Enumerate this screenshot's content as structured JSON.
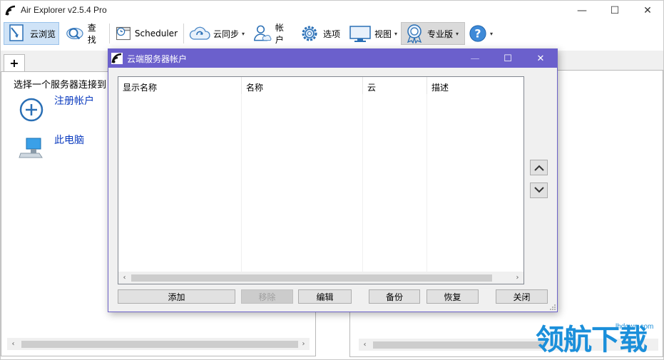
{
  "app": {
    "title": "Air Explorer v2.5.4 Pro"
  },
  "window_controls": {
    "minimize": "—",
    "maximize": "☐",
    "close": "✕"
  },
  "toolbar": {
    "browse": "云浏览",
    "search": "查找",
    "scheduler": "Scheduler",
    "sync": "云同步",
    "accounts": "帐户",
    "options": "选项",
    "view": "视图",
    "pro": "专业版",
    "caret": "▾"
  },
  "tabs": {
    "add": "+"
  },
  "left_pane": {
    "prompt": "选择一个服务器连接到",
    "items": [
      {
        "label": "注册帐户",
        "icon": "add-circle-icon"
      },
      {
        "label": "此电脑",
        "icon": "computer-icon"
      }
    ]
  },
  "dialog": {
    "title": "云端服务器帐户",
    "columns": [
      "显示名称",
      "名称",
      "云",
      "描述"
    ],
    "buttons": {
      "add": "添加",
      "remove": "移除",
      "edit": "编辑",
      "backup": "备份",
      "restore": "恢复",
      "close": "关闭"
    },
    "controls": {
      "minimize": "—",
      "maximize": "☐",
      "close": "✕"
    }
  },
  "scroll": {
    "left": "‹",
    "right": "›"
  },
  "watermark": {
    "text": "领航下载",
    "url": "lhdown.com"
  },
  "colors": {
    "dialog_title": "#6b60cc",
    "active_tool": "#cfe3f7",
    "link": "#0b3bbf"
  }
}
